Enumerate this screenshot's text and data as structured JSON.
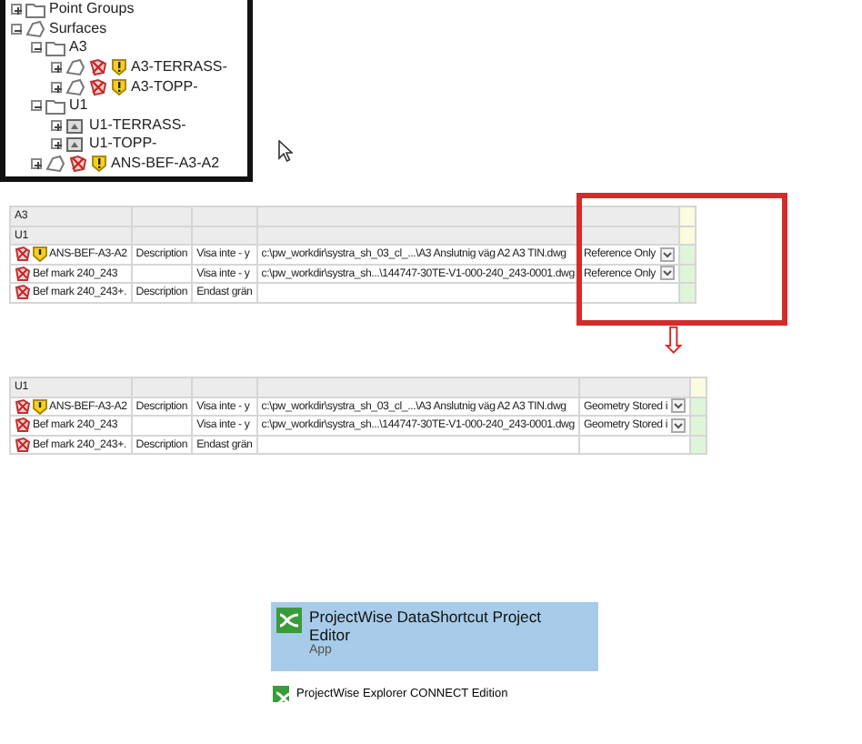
{
  "tree": {
    "items": [
      {
        "label": "Point Groups",
        "kind": "folder",
        "expanded": false,
        "warning": false
      },
      {
        "label": "Surfaces",
        "kind": "surface",
        "expanded": true,
        "warning": false,
        "children": [
          {
            "label": "A3",
            "kind": "folder",
            "expanded": true,
            "warning": false,
            "children": [
              {
                "label": "A3-TERRASS-",
                "kind": "surface",
                "expanded": false,
                "warning": true
              },
              {
                "label": "A3-TOPP-",
                "kind": "surface",
                "expanded": false,
                "warning": true
              }
            ]
          },
          {
            "label": "U1",
            "kind": "folder",
            "expanded": true,
            "warning": false,
            "children": [
              {
                "label": "U1-TERRASS-",
                "kind": "reference",
                "expanded": false,
                "warning": false
              },
              {
                "label": "U1-TOPP-",
                "kind": "reference",
                "expanded": false,
                "warning": false
              }
            ]
          },
          {
            "label": "ANS-BEF-A3-A2",
            "kind": "surface",
            "expanded": false,
            "warning": true
          }
        ]
      }
    ]
  },
  "table_before": {
    "groups": [
      "A3",
      "U1"
    ],
    "rows": [
      {
        "name": "ANS-BEF-A3-A2",
        "warning": true,
        "description": "Description",
        "style": "Visa inte - y",
        "path": "c:\\pw_workdir\\systra_sh_03_cl_...\\A3 Anslutnig väg A2 A3 TIN.dwg",
        "mode": "Reference Only"
      },
      {
        "name": "Bef mark 240_243",
        "warning": false,
        "style": "Visa inte - y",
        "path": "c:\\pw_workdir\\systra_sh...\\144747-30TE-V1-000-240_243-0001.dwg",
        "mode": "Reference Only"
      },
      {
        "name": "Bef mark 240_243+.",
        "warning": false,
        "description": "Description",
        "style": "Endast grän"
      }
    ]
  },
  "arrow": {
    "symbol": "⇩"
  },
  "table_after": {
    "groups": [
      "U1"
    ],
    "rows": [
      {
        "name": "ANS-BEF-A3-A2",
        "warning": true,
        "description": "Description",
        "style": "Visa inte - y",
        "path": "c:\\pw_workdir\\systra_sh_03_cl_...\\A3 Anslutnig väg A2 A3 TIN.dwg",
        "mode": "Geometry Stored i"
      },
      {
        "name": "Bef mark 240_243",
        "warning": false,
        "style": "Visa inte - y",
        "path": "c:\\pw_workdir\\systra_sh...\\144747-30TE-V1-000-240_243-0001.dwg",
        "mode": "Geometry Stored i"
      },
      {
        "name": "Bef mark 240_243+.",
        "warning": false,
        "description": "Description",
        "style": "Endast grän"
      }
    ]
  },
  "start_menu": {
    "best_match": {
      "title": "ProjectWise DataShortcut Project Editor",
      "subtitle": "App",
      "selected": true
    },
    "apps": [
      {
        "title": "ProjectWise Explorer CONNECT Edition"
      }
    ]
  }
}
